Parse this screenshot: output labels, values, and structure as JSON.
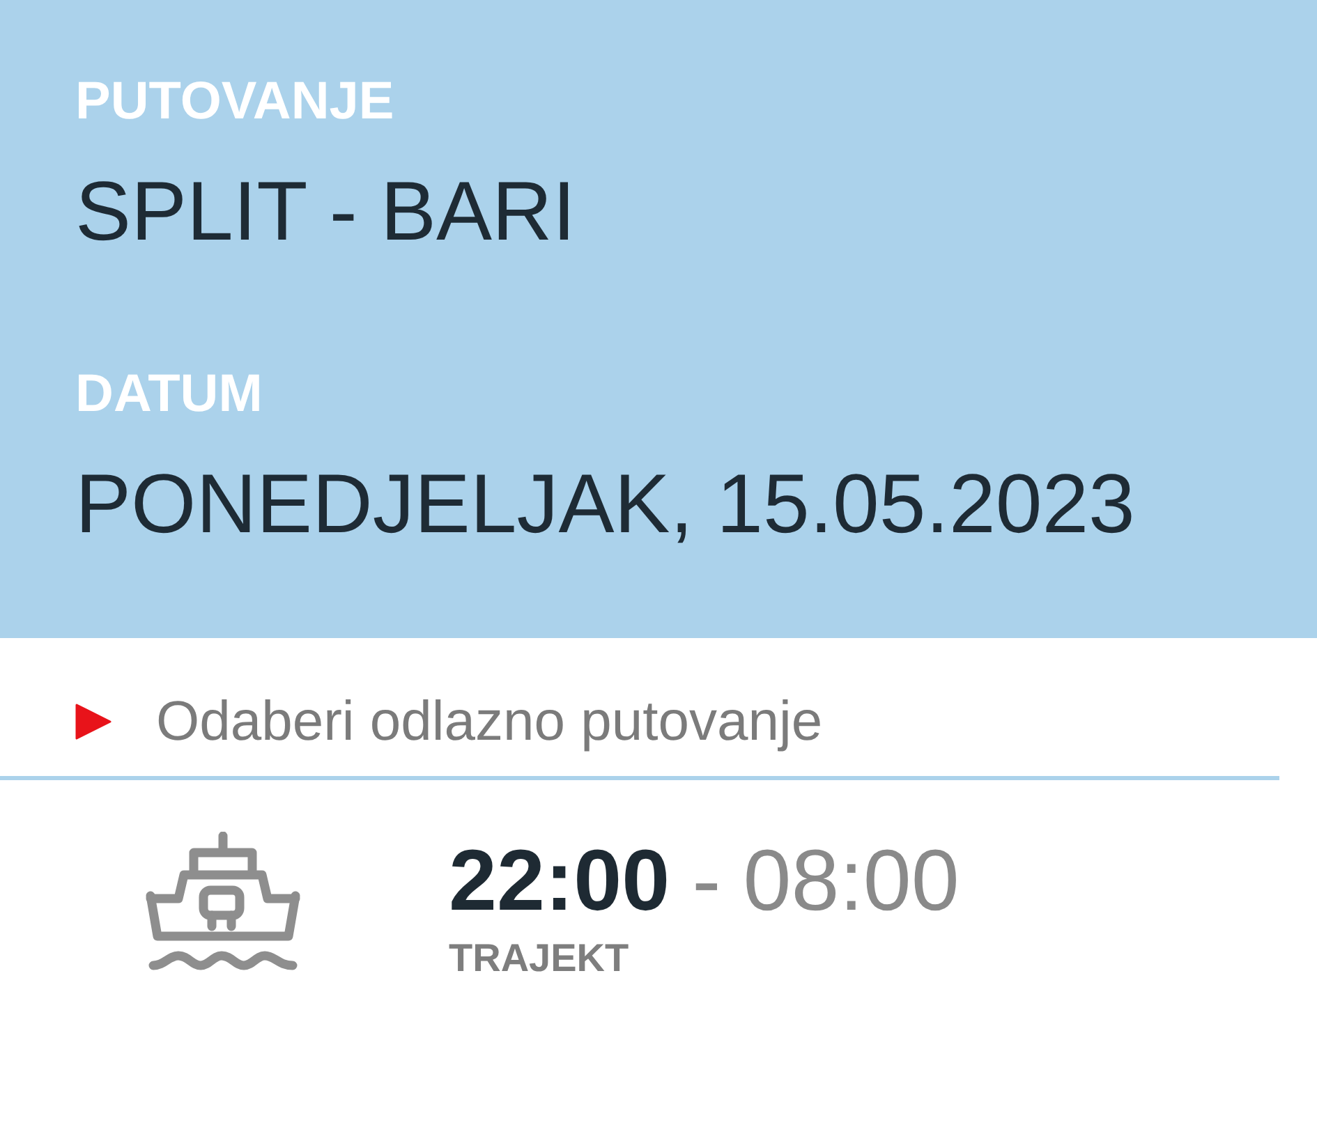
{
  "header_fields": [
    {
      "label": "PUTOVANJE",
      "value": "SPLIT - BARI"
    },
    {
      "label": "DATUM",
      "value": "PONEDJELJAK, 15.05.2023"
    }
  ],
  "section": {
    "title": "Odaberi odlazno putovanje"
  },
  "departures": [
    {
      "kind": "ferry",
      "departure_time": "22:00",
      "separator": "-",
      "arrival_time": "08:00",
      "type": "TRAJEKT"
    }
  ]
}
